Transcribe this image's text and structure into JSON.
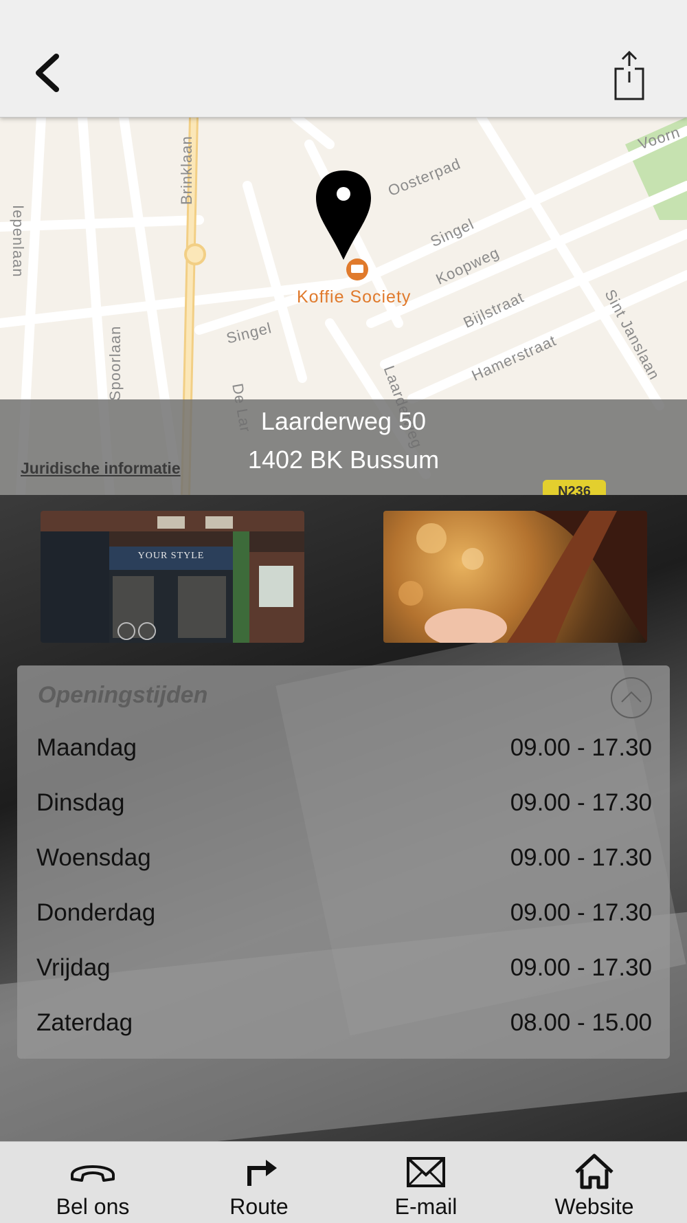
{
  "nav": {
    "back_icon": "chevron-left-icon",
    "share_icon": "share-icon"
  },
  "map": {
    "streets": [
      "Oosterpad",
      "Singel",
      "Koopweg",
      "Bijlstraat",
      "Hamerstraat",
      "Sint Janslaan",
      "Laarderweg",
      "Brinklaan",
      "Spoorlaan",
      "Singel",
      "Iepenlaan",
      "Voorn",
      "De Lar"
    ],
    "poi_label": "Koffie Society",
    "road_badge": "N236",
    "legal_link": "Juridische informatie"
  },
  "address": {
    "line1": "Laarderweg 50",
    "line2": "1402 BK Bussum"
  },
  "photos": {
    "shop_sign": "YOUR STYLE"
  },
  "hours": {
    "title": "Openingstijden",
    "rows": [
      {
        "day": "Maandag",
        "time": "09.00 - 17.30"
      },
      {
        "day": "Dinsdag",
        "time": "09.00 - 17.30"
      },
      {
        "day": "Woensdag",
        "time": "09.00 - 17.30"
      },
      {
        "day": "Donderdag",
        "time": "09.00 - 17.30"
      },
      {
        "day": "Vrijdag",
        "time": "09.00 - 17.30"
      },
      {
        "day": "Zaterdag",
        "time": "08.00 - 15.00"
      }
    ]
  },
  "tabs": [
    {
      "label": "Bel ons",
      "icon": "phone-icon"
    },
    {
      "label": "Route",
      "icon": "route-arrow-icon"
    },
    {
      "label": "E-mail",
      "icon": "mail-icon"
    },
    {
      "label": "Website",
      "icon": "home-icon"
    }
  ],
  "colors": {
    "poi": "#e07a2c",
    "map_bg": "#f5f1ea",
    "park": "#c6e2b0"
  }
}
